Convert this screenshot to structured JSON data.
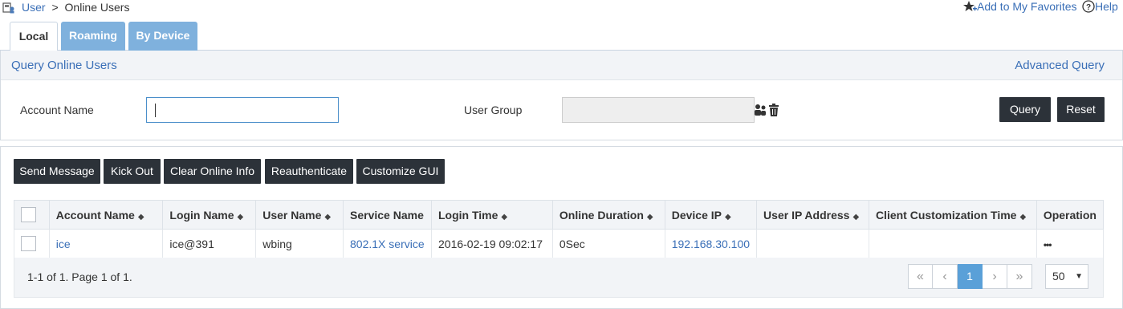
{
  "breadcrumb": {
    "parent": "User",
    "separator": ">",
    "current": "Online Users"
  },
  "header_links": {
    "favorites": "Add to My Favorites",
    "help": "Help"
  },
  "tabs": [
    {
      "label": "Local",
      "active": true
    },
    {
      "label": "Roaming",
      "active": false
    },
    {
      "label": "By Device",
      "active": false
    }
  ],
  "query": {
    "title": "Query Online Users",
    "advanced": "Advanced Query",
    "account_name_label": "Account Name",
    "account_name_value": "",
    "user_group_label": "User Group",
    "user_group_value": "",
    "query_button": "Query",
    "reset_button": "Reset"
  },
  "toolbar": {
    "send_message": "Send Message",
    "kick_out": "Kick Out",
    "clear_online_info": "Clear Online Info",
    "reauthenticate": "Reauthenticate",
    "customize_gui": "Customize GUI"
  },
  "table": {
    "sort_glyph": "◆",
    "headers": [
      "Account Name",
      "Login Name",
      "User Name",
      "Service Name",
      "Login Time",
      "Online Duration",
      "Device IP",
      "User IP Address",
      "Client Customization Time",
      "Operation"
    ],
    "rows": [
      {
        "account_name": "ice",
        "login_name": "ice@391",
        "user_name": "wbing",
        "service_name": "802.1X service",
        "login_time": "2016-02-19 09:02:17",
        "online_duration": "0Sec",
        "device_ip": "192.168.30.100",
        "user_ip": "",
        "client_customization_time": "",
        "operation": "•••"
      }
    ]
  },
  "pagination": {
    "summary": "1-1 of 1. Page 1 of 1.",
    "first": "«",
    "prev": "‹",
    "current_page": "1",
    "next": "›",
    "last": "»",
    "page_size": "50"
  },
  "colors": {
    "link": "#3a6fb7",
    "dark_button": "#2c3239",
    "tab_inactive": "#7fb1dd",
    "page_current": "#5aa0d8"
  }
}
